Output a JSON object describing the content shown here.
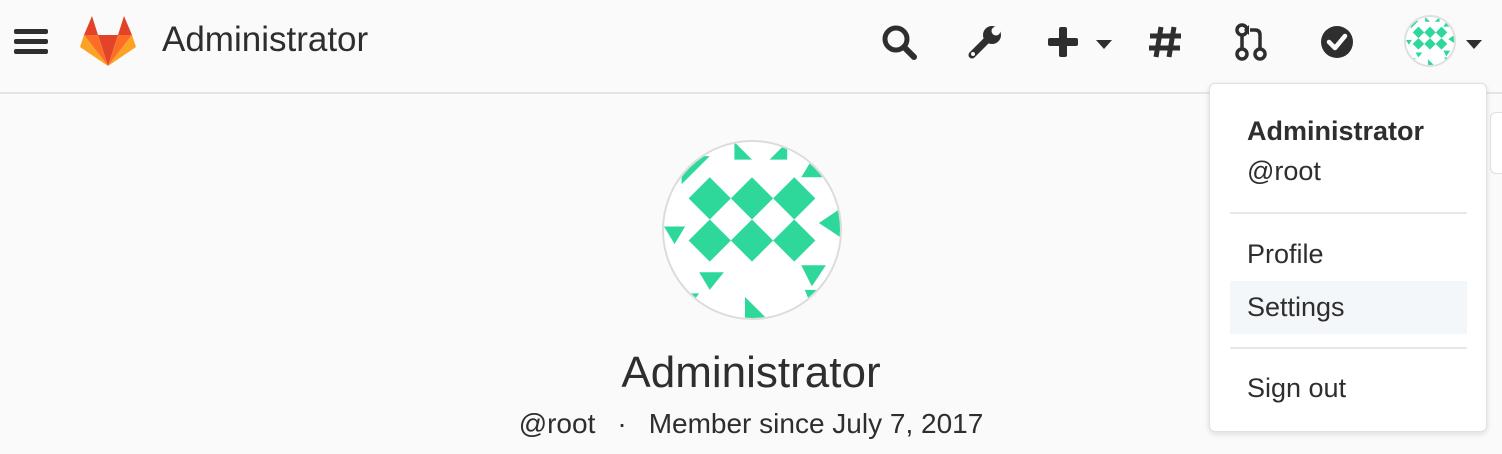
{
  "header": {
    "title": "Administrator",
    "icons": {
      "menu": "hamburger-icon",
      "logo": "gitlab-tanuki-logo",
      "search": "search-icon",
      "admin": "wrench-icon",
      "new": "plus-icon",
      "issues": "hash-icon",
      "merge_requests": "merge-request-icon",
      "todos": "check-circle-icon",
      "user_avatar": "identicon-avatar"
    }
  },
  "profile": {
    "name": "Administrator",
    "username": "@root",
    "separator": "·",
    "member_since": "Member since July 7, 2017"
  },
  "user_menu": {
    "name": "Administrator",
    "username": "@root",
    "items": [
      {
        "label": "Profile"
      },
      {
        "label": "Settings"
      },
      {
        "label": "Sign out"
      }
    ],
    "highlighted_item": "Settings"
  },
  "colors": {
    "identicon": "#2ed89b",
    "text": "#2e2e2e",
    "logo_orange": "#fc6d26",
    "logo_red": "#e24329",
    "logo_light": "#fca326",
    "menu_hover": "#f4f7fa"
  }
}
